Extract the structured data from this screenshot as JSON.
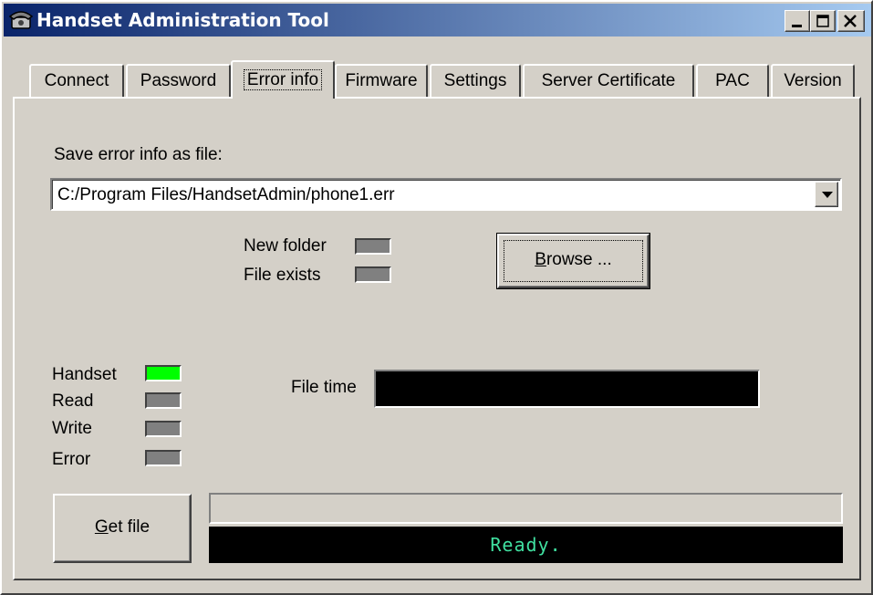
{
  "window": {
    "title": "Handset Administration Tool",
    "app_icon": "telephone-icon"
  },
  "titlebar_buttons": {
    "minimize": "minimize-icon",
    "maximize": "maximize-icon",
    "close": "close-icon"
  },
  "tabs": [
    {
      "label": "Connect"
    },
    {
      "label": "Password"
    },
    {
      "label": "Error info",
      "active": true
    },
    {
      "label": "Firmware"
    },
    {
      "label": "Settings"
    },
    {
      "label": "Server Certificate"
    },
    {
      "label": "PAC"
    },
    {
      "label": "Version"
    }
  ],
  "error_info": {
    "save_label": "Save error info as file:",
    "file_path": "C:/Program Files/HandsetAdmin/phone1.err",
    "new_folder_label": "New folder",
    "file_exists_label": "File exists",
    "browse_button": {
      "mnemonic": "B",
      "rest": "rowse ..."
    },
    "file_time_label": "File time",
    "file_time_value": "",
    "indicators": [
      {
        "label": "Handset",
        "state": "on",
        "color": "#00ff00"
      },
      {
        "label": "Read",
        "state": "off",
        "color": "#808080"
      },
      {
        "label": "Write",
        "state": "off",
        "color": "#808080"
      },
      {
        "label": "Error",
        "state": "off",
        "color": "#808080"
      }
    ],
    "get_file_button": {
      "mnemonic": "G",
      "rest": "et file"
    },
    "progress": 0,
    "status": "Ready."
  }
}
